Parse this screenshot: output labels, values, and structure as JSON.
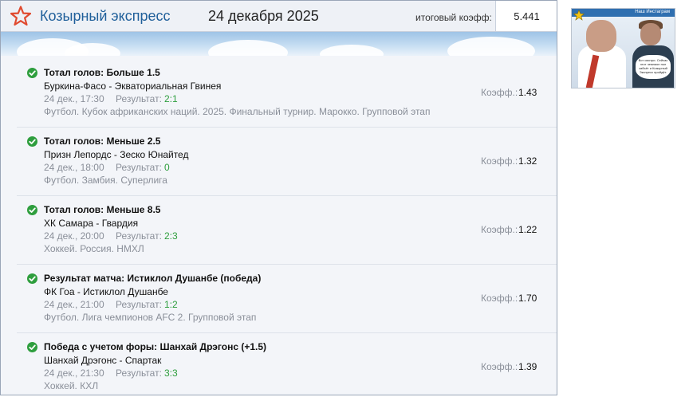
{
  "header": {
    "brand": "Козырный экспресс",
    "date": "24 декабря 2025",
    "total_label": "итоговый коэфф:",
    "total_value": "5.441"
  },
  "common": {
    "result_label": "Результат:",
    "coef_label": "Коэфф.:"
  },
  "bets": [
    {
      "market": "Тотал голов: Больше 1.5",
      "match": "Буркина-Фасо - Экваториальная Гвинея",
      "time": "24 дек., 17:30",
      "result": "2:1",
      "league": "Футбол. Кубок африканских наций. 2025. Финальный турнир. Марокко. Групповой этап",
      "coef": "1.43"
    },
    {
      "market": "Тотал голов: Меньше 2.5",
      "match": "Призн Лепордс - Зеско Юнайтед",
      "time": "24 дек., 18:00",
      "result": "0",
      "league": "Футбол. Замбия. Суперлига",
      "coef": "1.32"
    },
    {
      "market": "Тотал голов: Меньше 8.5",
      "match": "ХК Самара - Гвардия",
      "time": "24 дек., 20:00",
      "result": "2:3",
      "league": "Хоккей. Россия. НМХЛ",
      "coef": "1.22"
    },
    {
      "market": "Результат матча: Истиклол Душанбе (победа)",
      "match": "ФК Гоа - Истиклол Душанбе",
      "time": "24 дек., 21:00",
      "result": "1:2",
      "league": "Футбол. Лига чемпионов AFC 2. Групповой этап",
      "coef": "1.70"
    },
    {
      "market": "Победа с учетом форы: Шанхай Дрэгонс (+1.5)",
      "match": "Шанхай Дрэгонс - Спартак",
      "time": "24 дек., 21:30",
      "result": "3:3",
      "league": "Хоккей. КХЛ",
      "coef": "1.39"
    }
  ],
  "ad": {
    "top_text": "Наш Инстаграм",
    "bubble_text": "Вот смотри. Сейчас этот чемпион пол забьёт и Козырный Экспресс пройдёт."
  },
  "colors": {
    "brand": "#1f5f9a",
    "star": "#e04a2f",
    "check": "#2e9e3e",
    "result": "#2e9e3e"
  }
}
